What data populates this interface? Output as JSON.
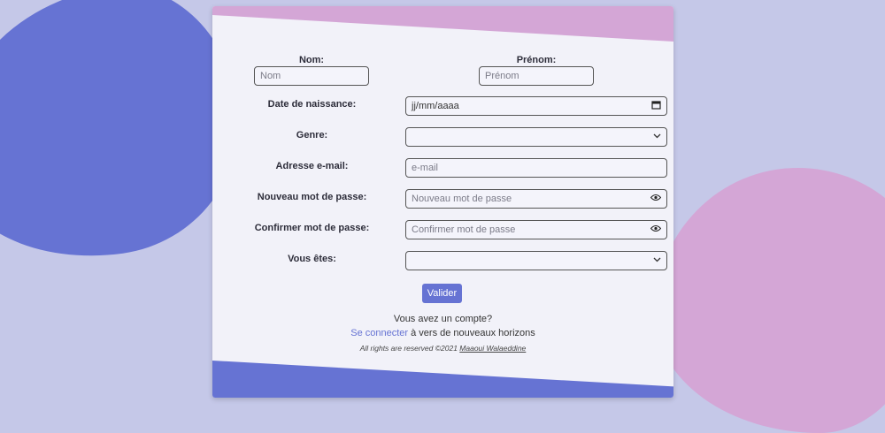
{
  "form": {
    "nom": {
      "label": "Nom:",
      "placeholder": "Nom"
    },
    "prenom": {
      "label": "Prénom:",
      "placeholder": "Prénom"
    },
    "date": {
      "label": "Date de naissance:",
      "placeholder": "jj/mm/aaaa"
    },
    "genre": {
      "label": "Genre:",
      "value": ""
    },
    "email": {
      "label": "Adresse e-mail:",
      "placeholder": "e-mail"
    },
    "password": {
      "label": "Nouveau mot de passe:",
      "placeholder": "Nouveau mot de passe"
    },
    "confirm": {
      "label": "Confirmer mot de passe:",
      "placeholder": "Confirmer mot de passe"
    },
    "role": {
      "label": "Vous êtes:",
      "value": ""
    },
    "submit_label": "Valider"
  },
  "footer": {
    "have_account": "Vous avez un compte?",
    "login_link": "Se connecter",
    "login_suffix": " à vers de nouveaux horizons",
    "rights_prefix": "All rights are reserved ©2021 ",
    "author": "Maaoui Walaeddine"
  },
  "colors": {
    "background": "#c5c8e8",
    "primary": "#6673d3",
    "accent": "#d4a6d6",
    "card": "#f2f2f9"
  },
  "icons": {
    "calendar": "calendar-icon",
    "chevron": "chevron-down-icon",
    "eye": "eye-icon"
  }
}
